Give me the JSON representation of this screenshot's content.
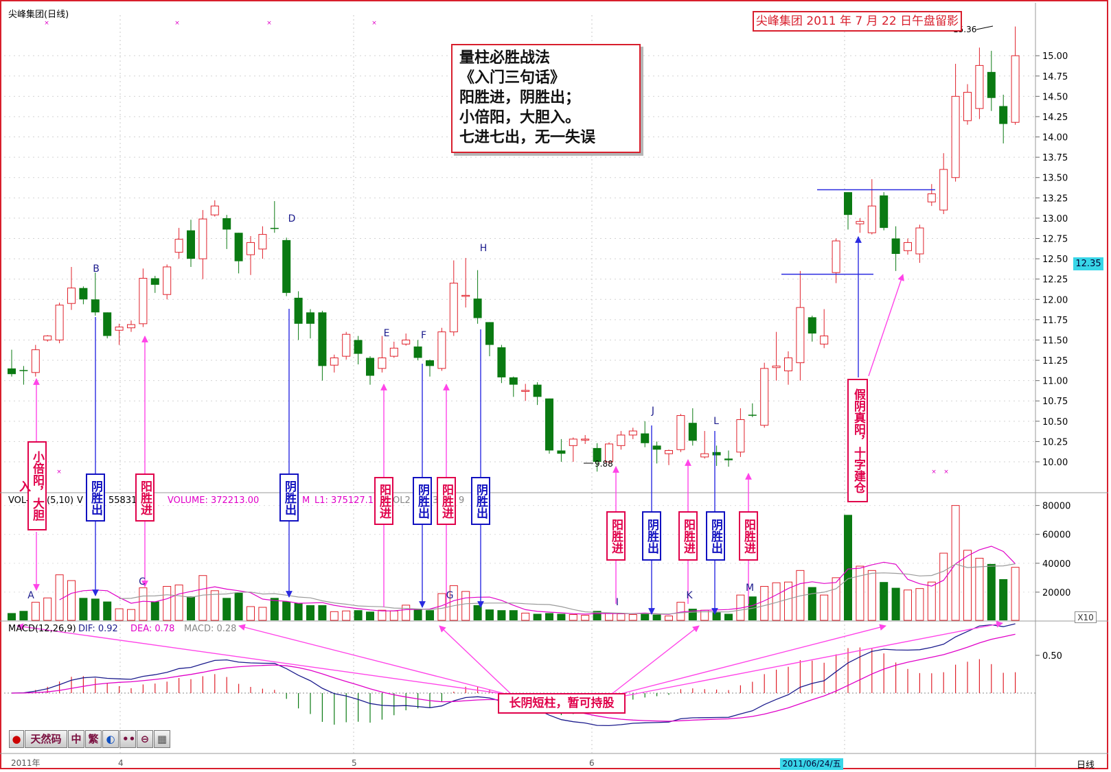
{
  "window": {
    "title": "尖峰集团(日线)",
    "snapshot_title": "尖峰集团 2011 年 7 月 22 日午盘留影",
    "period_label": "日线"
  },
  "strategy_box": {
    "lines": [
      "量柱必胜战法",
      "《入门三句话》",
      "阳胜进，阴胜出；",
      "小倍阳，大胆入。",
      "七进七出，无一失误"
    ]
  },
  "price_axis": {
    "ticks": [
      "15.00",
      "14.75",
      "14.50",
      "14.25",
      "14.00",
      "13.75",
      "13.50",
      "13.25",
      "13.00",
      "12.75",
      "12.50",
      "12.25",
      "12.00",
      "11.75",
      "11.50",
      "11.25",
      "11.00",
      "10.75",
      "10.50",
      "10.25",
      "10.00"
    ],
    "current_price": "12.35",
    "high_label": "15.36",
    "low_label": "9.88"
  },
  "volume_panel": {
    "header_vol": "VOL-",
    "header_ma": "(5,10)",
    "header_v": "V",
    "header_num": "558319",
    "header_volume": "VOLUME: 372213.00",
    "header_ma1": "M",
    "header_ma1_val": "L1: 375127.19",
    "header_ma2": "OL2",
    "header_ma2_tail": "3",
    "header_tail": "9",
    "ticks": [
      "80000",
      "60000",
      "40000",
      "20000"
    ],
    "multiplier": "X10"
  },
  "macd_panel": {
    "header": "MACD(12,26,9)",
    "dif": "DIF: 0.92",
    "dea": "DEA: 0.78",
    "macd": "MACD: 0.28",
    "tick": "0.50"
  },
  "time_axis": {
    "labels": [
      "2011年",
      "4",
      "5",
      "6"
    ],
    "selected_date": "2011/06/24/五"
  },
  "point_labels": [
    "A",
    "B",
    "C",
    "D",
    "E",
    "F",
    "G",
    "H",
    "I",
    "J",
    "K",
    "L",
    "M"
  ],
  "annotations": {
    "buy_small_double": "小倍阳，大胆入",
    "yin_out": "阴胜出",
    "yang_in": "阳胜进",
    "fake_yin": "假阴真阳，十字建仓",
    "hold_note": "长阴短柱，暂可持股"
  },
  "toolbar": {
    "items": [
      "天然码",
      "中",
      "繁"
    ]
  },
  "colors": {
    "up": "#e0202a",
    "down": "#0a7a12",
    "ma1": "#e000c8",
    "ma2": "#9a9a9a",
    "dif": "#1a1a8c",
    "dea": "#e000c8",
    "arrow_magenta": "#ff44e8",
    "arrow_blue": "#2a2ae0",
    "frame": "#d81e2c"
  },
  "chart_data": {
    "type": "candlestick",
    "price_ylim": [
      9.62,
      15.5
    ],
    "volume_ylim": [
      0,
      86000
    ],
    "candles": [
      {
        "o": 11.15,
        "c": 11.08,
        "h": 11.38,
        "l": 11.05,
        "v": 5500
      },
      {
        "o": 11.13,
        "c": 11.12,
        "h": 11.18,
        "l": 10.95,
        "v": 7000
      },
      {
        "o": 11.1,
        "c": 11.38,
        "h": 11.44,
        "l": 11.05,
        "v": 13000
      },
      {
        "o": 11.5,
        "c": 11.55,
        "h": 11.56,
        "l": 11.48,
        "v": 16000
      },
      {
        "o": 11.5,
        "c": 11.93,
        "h": 11.96,
        "l": 11.46,
        "v": 32000
      },
      {
        "o": 11.95,
        "c": 12.14,
        "h": 12.4,
        "l": 11.87,
        "v": 28000
      },
      {
        "o": 12.14,
        "c": 12.0,
        "h": 12.16,
        "l": 11.94,
        "v": 16000
      },
      {
        "o": 12.0,
        "c": 11.84,
        "h": 12.33,
        "l": 11.8,
        "v": 15500
      },
      {
        "o": 11.84,
        "c": 11.55,
        "h": 11.84,
        "l": 11.52,
        "v": 13500
      },
      {
        "o": 11.62,
        "c": 11.66,
        "h": 11.7,
        "l": 11.44,
        "v": 8500
      },
      {
        "o": 11.65,
        "c": 11.69,
        "h": 11.74,
        "l": 11.6,
        "v": 8000
      },
      {
        "o": 11.7,
        "c": 12.26,
        "h": 12.38,
        "l": 11.66,
        "v": 23000
      },
      {
        "o": 12.26,
        "c": 12.18,
        "h": 12.29,
        "l": 12.08,
        "v": 13500
      },
      {
        "o": 12.06,
        "c": 12.4,
        "h": 12.43,
        "l": 12.0,
        "v": 24000
      },
      {
        "o": 12.58,
        "c": 12.74,
        "h": 12.88,
        "l": 12.5,
        "v": 25000
      },
      {
        "o": 12.85,
        "c": 12.5,
        "h": 12.98,
        "l": 12.4,
        "v": 17000
      },
      {
        "o": 12.5,
        "c": 12.99,
        "h": 13.1,
        "l": 12.25,
        "v": 31500
      },
      {
        "o": 13.04,
        "c": 13.15,
        "h": 13.22,
        "l": 13.02,
        "v": 21000
      },
      {
        "o": 13.0,
        "c": 12.86,
        "h": 13.04,
        "l": 12.62,
        "v": 16000
      },
      {
        "o": 12.82,
        "c": 12.47,
        "h": 12.82,
        "l": 12.32,
        "v": 19500
      },
      {
        "o": 12.55,
        "c": 12.7,
        "h": 12.78,
        "l": 12.3,
        "v": 10000
      },
      {
        "o": 12.62,
        "c": 12.8,
        "h": 12.9,
        "l": 12.5,
        "v": 9500
      },
      {
        "o": 12.88,
        "c": 12.87,
        "h": 13.21,
        "l": 12.82,
        "v": 16000
      },
      {
        "o": 12.73,
        "c": 12.08,
        "h": 12.76,
        "l": 12.04,
        "v": 13500
      },
      {
        "o": 12.02,
        "c": 11.7,
        "h": 12.1,
        "l": 11.5,
        "v": 12500
      },
      {
        "o": 11.84,
        "c": 11.7,
        "h": 11.88,
        "l": 11.52,
        "v": 11000
      },
      {
        "o": 11.84,
        "c": 11.18,
        "h": 11.86,
        "l": 11.0,
        "v": 11000
      },
      {
        "o": 11.19,
        "c": 11.28,
        "h": 11.32,
        "l": 11.1,
        "v": 6500
      },
      {
        "o": 11.3,
        "c": 11.57,
        "h": 11.6,
        "l": 11.26,
        "v": 7000
      },
      {
        "o": 11.5,
        "c": 11.33,
        "h": 11.55,
        "l": 11.2,
        "v": 7500
      },
      {
        "o": 11.28,
        "c": 11.06,
        "h": 11.3,
        "l": 10.95,
        "v": 6500
      },
      {
        "o": 11.15,
        "c": 11.28,
        "h": 11.55,
        "l": 11.1,
        "v": 7500
      },
      {
        "o": 11.3,
        "c": 11.4,
        "h": 11.48,
        "l": 11.28,
        "v": 7000
      },
      {
        "o": 11.45,
        "c": 11.5,
        "h": 11.58,
        "l": 11.43,
        "v": 11000
      },
      {
        "o": 11.42,
        "c": 11.28,
        "h": 11.5,
        "l": 11.25,
        "v": 8500
      },
      {
        "o": 11.25,
        "c": 11.18,
        "h": 11.26,
        "l": 11.05,
        "v": 7500
      },
      {
        "o": 11.15,
        "c": 11.6,
        "h": 11.65,
        "l": 11.12,
        "v": 19000
      },
      {
        "o": 11.6,
        "c": 12.2,
        "h": 12.48,
        "l": 11.55,
        "v": 24500
      },
      {
        "o": 12.05,
        "c": 12.05,
        "h": 12.51,
        "l": 11.9,
        "v": 20500
      },
      {
        "o": 12.01,
        "c": 11.77,
        "h": 12.36,
        "l": 11.7,
        "v": 11000
      },
      {
        "o": 11.72,
        "c": 11.44,
        "h": 11.72,
        "l": 11.3,
        "v": 8000
      },
      {
        "o": 11.41,
        "c": 11.04,
        "h": 11.44,
        "l": 10.97,
        "v": 7500
      },
      {
        "o": 11.04,
        "c": 10.95,
        "h": 11.05,
        "l": 10.8,
        "v": 7500
      },
      {
        "o": 10.88,
        "c": 10.88,
        "h": 10.96,
        "l": 10.75,
        "v": 5500
      },
      {
        "o": 10.95,
        "c": 10.8,
        "h": 10.98,
        "l": 10.7,
        "v": 5000
      },
      {
        "o": 10.78,
        "c": 10.14,
        "h": 10.78,
        "l": 10.1,
        "v": 5500
      },
      {
        "o": 10.14,
        "c": 10.1,
        "h": 10.28,
        "l": 10.0,
        "v": 5000
      },
      {
        "o": 10.2,
        "c": 10.28,
        "h": 10.3,
        "l": 10.0,
        "v": 4500
      },
      {
        "o": 10.28,
        "c": 10.28,
        "h": 10.33,
        "l": 10.22,
        "v": 4000
      },
      {
        "o": 10.17,
        "c": 10.0,
        "h": 10.23,
        "l": 9.88,
        "v": 7000
      },
      {
        "o": 10.0,
        "c": 10.22,
        "h": 10.24,
        "l": 9.97,
        "v": 5500
      },
      {
        "o": 10.2,
        "c": 10.33,
        "h": 10.38,
        "l": 10.15,
        "v": 5000
      },
      {
        "o": 10.33,
        "c": 10.38,
        "h": 10.42,
        "l": 10.28,
        "v": 4500
      },
      {
        "o": 10.35,
        "c": 10.23,
        "h": 10.5,
        "l": 10.18,
        "v": 5500
      },
      {
        "o": 10.2,
        "c": 10.15,
        "h": 10.25,
        "l": 9.98,
        "v": 4500
      },
      {
        "o": 10.1,
        "c": 10.14,
        "h": 10.15,
        "l": 9.96,
        "v": 3500
      },
      {
        "o": 10.15,
        "c": 10.57,
        "h": 10.59,
        "l": 10.12,
        "v": 13000
      },
      {
        "o": 10.48,
        "c": 10.26,
        "h": 10.66,
        "l": 10.2,
        "v": 8500
      },
      {
        "o": 10.06,
        "c": 10.1,
        "h": 10.38,
        "l": 10.04,
        "v": 7500
      },
      {
        "o": 10.12,
        "c": 10.08,
        "h": 10.2,
        "l": 9.95,
        "v": 6000
      },
      {
        "o": 10.04,
        "c": 10.02,
        "h": 10.14,
        "l": 9.94,
        "v": 5000
      },
      {
        "o": 10.12,
        "c": 10.52,
        "h": 10.66,
        "l": 10.06,
        "v": 18000
      },
      {
        "o": 10.58,
        "c": 10.57,
        "h": 10.72,
        "l": 10.55,
        "v": 17000
      },
      {
        "o": 10.45,
        "c": 11.15,
        "h": 11.22,
        "l": 10.42,
        "v": 24000
      },
      {
        "o": 11.16,
        "c": 11.18,
        "h": 11.6,
        "l": 11.0,
        "v": 26500
      },
      {
        "o": 11.12,
        "c": 11.28,
        "h": 11.36,
        "l": 10.95,
        "v": 27000
      },
      {
        "o": 11.22,
        "c": 11.9,
        "h": 12.35,
        "l": 11.0,
        "v": 35000
      },
      {
        "o": 11.78,
        "c": 11.58,
        "h": 11.8,
        "l": 11.48,
        "v": 23500
      },
      {
        "o": 11.45,
        "c": 11.55,
        "h": 11.88,
        "l": 11.4,
        "v": 18000
      },
      {
        "o": 12.33,
        "c": 12.72,
        "h": 12.75,
        "l": 12.2,
        "v": 30000
      },
      {
        "o": 13.32,
        "c": 13.04,
        "h": 13.32,
        "l": 12.86,
        "v": 73500
      },
      {
        "o": 12.93,
        "c": 12.96,
        "h": 13.0,
        "l": 12.82,
        "v": 38000
      },
      {
        "o": 12.82,
        "c": 13.15,
        "h": 13.48,
        "l": 12.8,
        "v": 35000
      },
      {
        "o": 13.28,
        "c": 12.88,
        "h": 13.32,
        "l": 12.85,
        "v": 27000
      },
      {
        "o": 12.75,
        "c": 12.56,
        "h": 12.9,
        "l": 12.35,
        "v": 23000
      },
      {
        "o": 12.6,
        "c": 12.7,
        "h": 12.75,
        "l": 12.55,
        "v": 21500
      },
      {
        "o": 12.56,
        "c": 12.88,
        "h": 12.92,
        "l": 12.45,
        "v": 22500
      },
      {
        "o": 13.2,
        "c": 13.3,
        "h": 13.42,
        "l": 13.15,
        "v": 27000
      },
      {
        "o": 13.1,
        "c": 13.6,
        "h": 13.8,
        "l": 13.05,
        "v": 47000
      },
      {
        "o": 13.5,
        "c": 14.5,
        "h": 14.9,
        "l": 13.45,
        "v": 80000
      },
      {
        "o": 14.2,
        "c": 14.55,
        "h": 14.65,
        "l": 14.15,
        "v": 49000
      },
      {
        "o": 14.35,
        "c": 14.88,
        "h": 15.1,
        "l": 14.22,
        "v": 43500
      },
      {
        "o": 14.8,
        "c": 14.48,
        "h": 15.06,
        "l": 14.32,
        "v": 39500
      },
      {
        "o": 14.38,
        "c": 14.16,
        "h": 14.52,
        "l": 13.92,
        "v": 29000
      },
      {
        "o": 14.18,
        "c": 15.0,
        "h": 15.36,
        "l": 14.15,
        "v": 37200
      }
    ]
  }
}
